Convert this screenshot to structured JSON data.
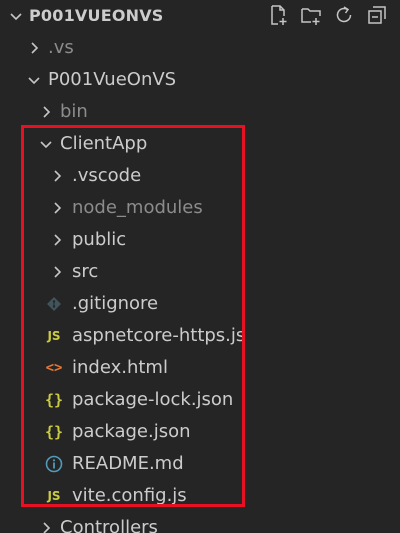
{
  "explorer": {
    "title": "P001VUEONVS",
    "actions": [
      {
        "name": "new-file-icon"
      },
      {
        "name": "new-folder-icon"
      },
      {
        "name": "refresh-icon"
      },
      {
        "name": "collapse-all-icon"
      }
    ]
  },
  "tree": {
    "vs": {
      "label": ".vs",
      "icon": "chevron-right-icon"
    },
    "project": {
      "label": "P001VueOnVS",
      "icon": "chevron-down-icon"
    },
    "bin": {
      "label": "bin",
      "icon": "chevron-right-icon"
    },
    "clientapp": {
      "label": "ClientApp",
      "icon": "chevron-down-icon"
    },
    "vscode": {
      "label": ".vscode",
      "icon": "chevron-right-icon"
    },
    "node_modules": {
      "label": "node_modules",
      "icon": "chevron-right-icon"
    },
    "public": {
      "label": "public",
      "icon": "chevron-right-icon"
    },
    "src": {
      "label": "src",
      "icon": "chevron-right-icon"
    },
    "gitignore": {
      "label": ".gitignore",
      "icon": "git-icon"
    },
    "aspnetcore": {
      "label": "aspnetcore-https.js",
      "icon": "js-icon",
      "icon_text": "JS"
    },
    "index_html": {
      "label": "index.html",
      "icon": "html-icon",
      "icon_text": "<>"
    },
    "package_lock": {
      "label": "package-lock.json",
      "icon": "json-icon",
      "icon_text": "{}"
    },
    "package_json": {
      "label": "package.json",
      "icon": "json-icon",
      "icon_text": "{}"
    },
    "readme": {
      "label": "README.md",
      "icon": "info-icon"
    },
    "vite_config": {
      "label": "vite.config.js",
      "icon": "js-icon",
      "icon_text": "JS"
    },
    "controllers": {
      "label": "Controllers",
      "icon": "chevron-right-icon"
    }
  },
  "colors": {
    "background": "#252526",
    "text": "#cccccc",
    "dim_text": "#8c8c8c",
    "js_yellow": "#cbcb41",
    "html_orange": "#e37933",
    "info_blue": "#519aba",
    "highlight_red": "#e81123"
  }
}
